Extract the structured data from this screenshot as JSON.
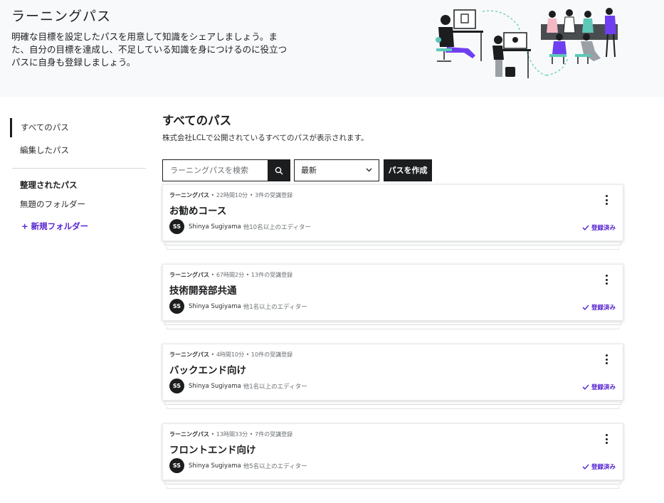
{
  "header": {
    "title": "ラーニングパス",
    "description_lines": [
      "明確な目標を設定したパスを用意して知識をシェアしましょう。ま",
      "た、自分の目標を達成し、不足している知識を身につけるのに役立つ",
      "パスに自身も登録しましょう。"
    ]
  },
  "sidebar": {
    "items": [
      {
        "label": "すべてのパス",
        "active": true
      },
      {
        "label": "編集したパス",
        "active": false
      }
    ],
    "organized_heading": "整理されたパス",
    "folders": [
      {
        "label": "無題のフォルダー"
      }
    ],
    "new_folder_plus": "+",
    "new_folder_label": "新規フォルダー"
  },
  "main": {
    "title": "すべてのパス",
    "subtitle": "株式会社LCLで公開されているすべてのパスが表示されます。",
    "search": {
      "placeholder": "ラーニングパスを検索",
      "value": "",
      "icon": "search-icon"
    },
    "sort": {
      "selected": "最新",
      "icon": "chevron-down-icon"
    },
    "create_button": "パスを作成"
  },
  "cards": [
    {
      "type": "ラーニングパス",
      "bullet": "•",
      "duration": "22時間10分",
      "enrollment": "3件の受講登録",
      "title": "お勧めコース",
      "avatar_initials": "SS",
      "owner": "Shinya Sugiyama",
      "editors": "他10名以上のエディター",
      "status": "登録済み"
    },
    {
      "type": "ラーニングパス",
      "bullet": "•",
      "duration": "67時間2分",
      "enrollment": "13件の受講登録",
      "title": "技術開発部共通",
      "avatar_initials": "SS",
      "owner": "Shinya Sugiyama",
      "editors": "他1名以上のエディター",
      "status": "登録済み"
    },
    {
      "type": "ラーニングパス",
      "bullet": "•",
      "duration": "4時間10分",
      "enrollment": "10件の受講登録",
      "title": "バックエンド向け",
      "avatar_initials": "SS",
      "owner": "Shinya Sugiyama",
      "editors": "他1名以上のエディター",
      "status": "登録済み"
    },
    {
      "type": "ラーニングパス",
      "bullet": "•",
      "duration": "13時間33分",
      "enrollment": "7件の受講登録",
      "title": "フロントエンド向け",
      "avatar_initials": "SS",
      "owner": "Shinya Sugiyama",
      "editors": "他5名以上のエディター",
      "status": "登録済み"
    }
  ],
  "colors": {
    "accent": "#5624d0",
    "dark": "#1c1d1f",
    "banner_bg": "#f7f9fa",
    "illustration_teal": "#5dc8b8",
    "illustration_purple": "#6e3ff0"
  }
}
